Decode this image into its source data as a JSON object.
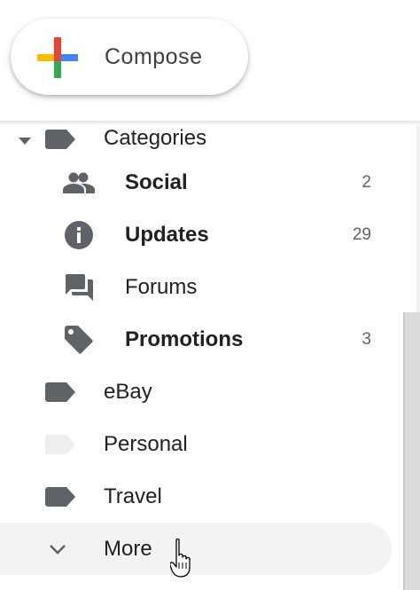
{
  "compose": {
    "label": "Compose",
    "icon": "compose-plus-icon"
  },
  "categories": {
    "label": "Categories",
    "expand_icon": "caret-down-icon",
    "label_icon": "label-icon",
    "color": "#5f6368",
    "items": [
      {
        "label": "Social",
        "count": "2",
        "bold": true,
        "icon": "people-icon"
      },
      {
        "label": "Updates",
        "count": "29",
        "bold": true,
        "icon": "info-icon"
      },
      {
        "label": "Forums",
        "count": "",
        "bold": false,
        "icon": "forum-icon"
      },
      {
        "label": "Promotions",
        "count": "3",
        "bold": true,
        "icon": "tag-icon"
      }
    ]
  },
  "labels": [
    {
      "label": "eBay",
      "color": "#5f6368",
      "icon": "label-icon"
    },
    {
      "label": "Personal",
      "color": "#eeeeee",
      "icon": "label-icon"
    },
    {
      "label": "Travel",
      "color": "#5f6368",
      "icon": "label-icon"
    }
  ],
  "more": {
    "label": "More",
    "icon": "chevron-down-icon"
  },
  "colors": {
    "google_red": "#ea4335",
    "google_yellow": "#fbbc04",
    "google_green": "#34a853",
    "google_blue": "#4285f4",
    "icon_gray": "#5f6368",
    "hover_bg": "#f1f3f4"
  }
}
